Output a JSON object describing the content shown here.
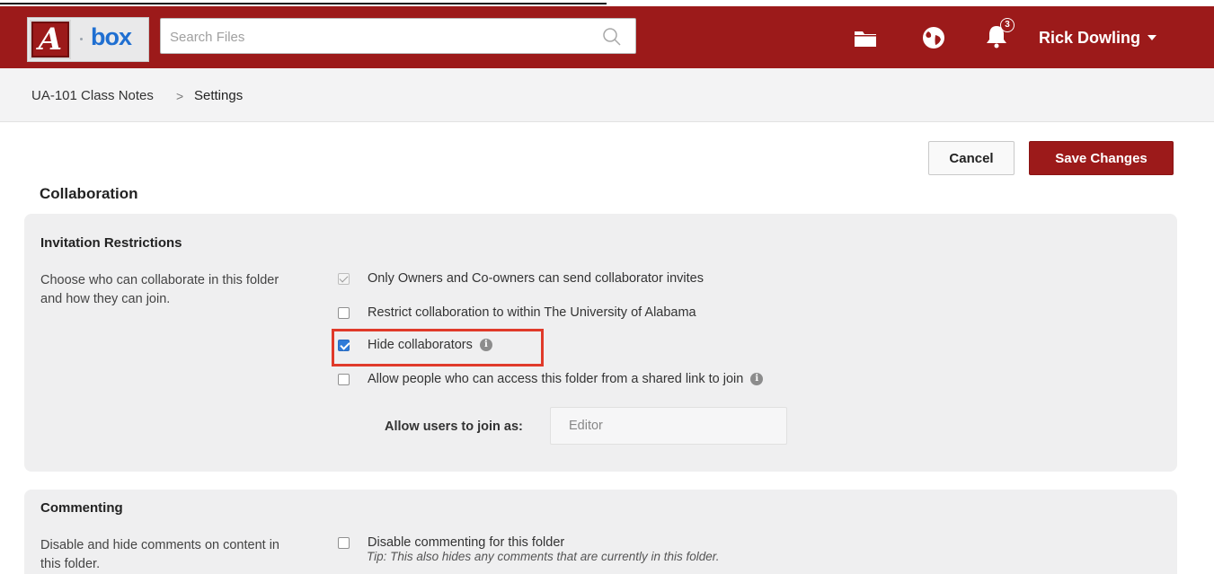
{
  "header": {
    "logo_letter": "A",
    "logo_text": "box",
    "search_placeholder": "Search Files",
    "notification_count": "3",
    "user_name": "Rick Dowling"
  },
  "breadcrumb": {
    "root": "UA-101 Class Notes",
    "separator": ">",
    "current": "Settings"
  },
  "actions": {
    "cancel_label": "Cancel",
    "save_label": "Save Changes"
  },
  "collaboration": {
    "title": "Collaboration",
    "invitation": {
      "heading": "Invitation Restrictions",
      "description": "Choose who can collaborate in this folder and how they can join.",
      "options": [
        {
          "label": "Only Owners and Co-owners can send collaborator invites",
          "state": "checked-disabled"
        },
        {
          "label": "Restrict collaboration to within The University of Alabama",
          "state": "unchecked"
        },
        {
          "label": "Hide collaborators",
          "state": "checked",
          "info": true
        },
        {
          "label": "Allow people who can access this folder from a shared link to join",
          "state": "unchecked",
          "info": true
        }
      ],
      "join_as_label": "Allow users to join as:",
      "join_as_value": "Editor"
    }
  },
  "commenting": {
    "heading": "Commenting",
    "description": "Disable and hide comments on content in this folder.",
    "option_label": "Disable commenting for this folder",
    "option_state": "unchecked",
    "tip": "Tip: This also hides any comments that are currently in this folder."
  },
  "colors": {
    "brand": "#9c1a1a",
    "checkbox_accent": "#2f7bd9",
    "highlight": "#e03a2a"
  }
}
